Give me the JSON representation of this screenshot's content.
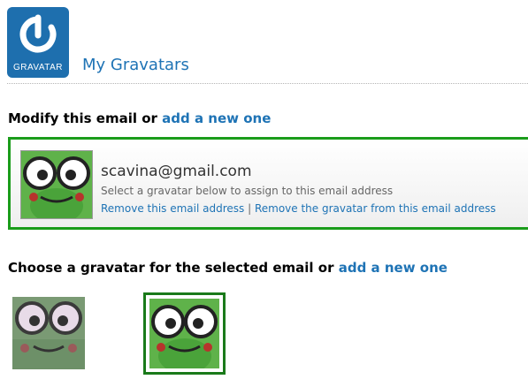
{
  "header": {
    "logo_text": "GRAVATAR",
    "title": "My Gravatars"
  },
  "modify_section": {
    "heading": "Modify this email or ",
    "add_link": "add a new one"
  },
  "email_panel": {
    "email": "scavina@gmail.com",
    "hint": "Select a gravatar below to assign to this email address",
    "remove_email_link": "Remove this email address",
    "separator": " | ",
    "remove_gravatar_link": "Remove the gravatar from this email address"
  },
  "choose_section": {
    "heading": "Choose a gravatar for the selected email or ",
    "add_link": "add a new one"
  },
  "colors": {
    "accent": "#1e73b5",
    "selected_border": "#1a9c1a",
    "logo_bg": "#1e6fae"
  }
}
